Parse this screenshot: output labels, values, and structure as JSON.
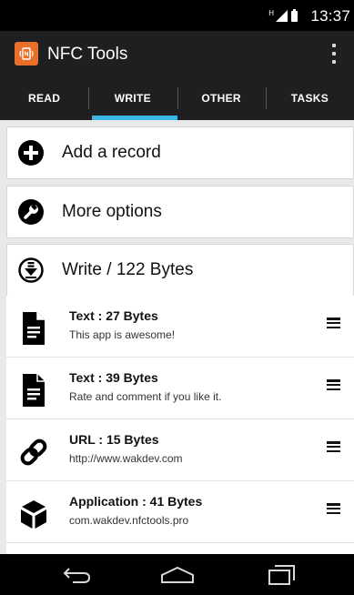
{
  "status_bar": {
    "network_mark": "H",
    "time": "13:37"
  },
  "app_bar": {
    "title": "NFC Tools",
    "logo_icon": "nfc-icon",
    "menu_icon": "overflow-menu-icon"
  },
  "tabs": [
    {
      "label": "READ",
      "active": false
    },
    {
      "label": "WRITE",
      "active": true
    },
    {
      "label": "OTHER",
      "active": false
    },
    {
      "label": "TASKS",
      "active": false
    }
  ],
  "actions": [
    {
      "label": "Add a record",
      "icon": "add-circle-icon"
    },
    {
      "label": "More options",
      "icon": "wrench-circle-icon"
    },
    {
      "label": "Write / 122 Bytes",
      "icon": "download-circle-icon"
    }
  ],
  "records": [
    {
      "title": "Text : 27 Bytes",
      "subtitle": "This app is awesome!",
      "icon": "document-icon"
    },
    {
      "title": "Text : 39 Bytes",
      "subtitle": "Rate and comment if you like it.",
      "icon": "document-icon"
    },
    {
      "title": "URL : 15 Bytes",
      "subtitle": "http://www.wakdev.com",
      "icon": "link-icon"
    },
    {
      "title": "Application : 41 Bytes",
      "subtitle": "com.wakdev.nfctools.pro",
      "icon": "cube-icon"
    }
  ],
  "colors": {
    "accent": "#3ab7e6",
    "logo": "#e8702a",
    "app_bar": "#1e1f21"
  }
}
